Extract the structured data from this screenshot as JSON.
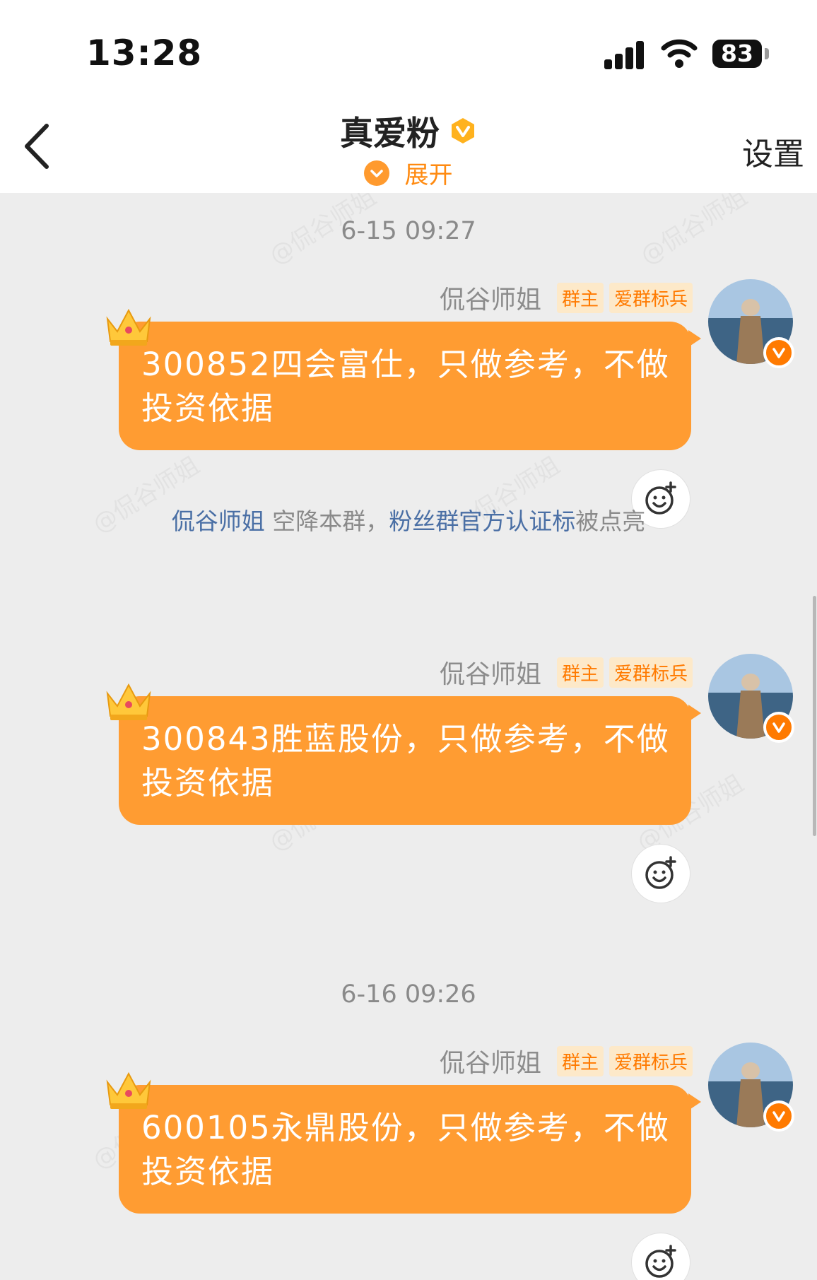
{
  "status_bar": {
    "time": "13:28",
    "battery": "83"
  },
  "header": {
    "title": "真爱粉",
    "expand_label": "展开",
    "settings_label": "设置"
  },
  "chat": {
    "watermark": "@侃谷师姐",
    "timestamps": [
      "6-15 09:27",
      "6-16 09:26"
    ],
    "system_message": {
      "user": "侃谷师姐",
      "text1": " 空降本群，",
      "highlight": "粉丝群官方认证标",
      "text2": "被点亮"
    },
    "messages": [
      {
        "sender": "侃谷师姐",
        "tags": [
          "群主",
          "爱群标兵"
        ],
        "text": "300852四会富仕，只做参考，不做投资依据"
      },
      {
        "sender": "侃谷师姐",
        "tags": [
          "群主",
          "爱群标兵"
        ],
        "text": "300843胜蓝股份，只做参考，不做投资依据"
      },
      {
        "sender": "侃谷师姐",
        "tags": [
          "群主",
          "爱群标兵"
        ],
        "text": "600105永鼎股份，只做参考，不做投资依据"
      }
    ]
  },
  "colors": {
    "bubble": "#ff9c32",
    "accent": "#ff8a10",
    "link": "#4a6fa5"
  },
  "icons": [
    "chevron-left-icon",
    "verified-v-icon",
    "chevron-down-icon",
    "crown-icon",
    "add-emoji-reaction-icon",
    "signal-icon",
    "wifi-icon",
    "battery-icon"
  ]
}
